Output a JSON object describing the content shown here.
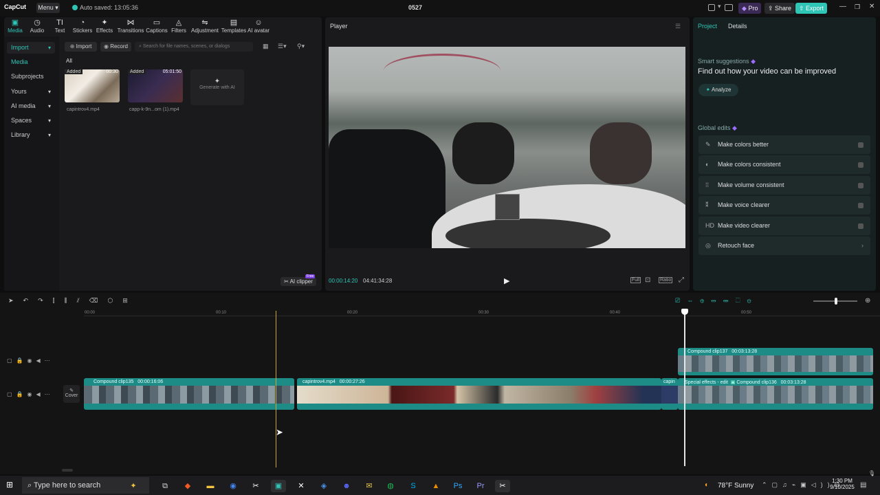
{
  "app": {
    "logo": "CapCut",
    "menu_label": "Menu",
    "autosave": "Auto saved: 13:05:36",
    "project_title": "0527",
    "pro_label": "Pro",
    "share_label": "Share",
    "export_label": "Export"
  },
  "toolbar": [
    {
      "label": "Media",
      "icon": "media-icon",
      "glyph": "▣"
    },
    {
      "label": "Audio",
      "icon": "audio-icon",
      "glyph": "◷"
    },
    {
      "label": "Text",
      "icon": "text-icon",
      "glyph": "TI"
    },
    {
      "label": "Stickers",
      "icon": "stickers-icon",
      "glyph": "◔"
    },
    {
      "label": "Effects",
      "icon": "effects-icon",
      "glyph": "✦"
    },
    {
      "label": "Transitions",
      "icon": "transitions-icon",
      "glyph": "⋈"
    },
    {
      "label": "Captions",
      "icon": "captions-icon",
      "glyph": "▭"
    },
    {
      "label": "Filters",
      "icon": "filters-icon",
      "glyph": "◬"
    },
    {
      "label": "Adjustment",
      "icon": "adjustment-icon",
      "glyph": "⇋"
    },
    {
      "label": "Templates",
      "icon": "templates-icon",
      "glyph": "▤"
    },
    {
      "label": "AI avatar",
      "icon": "ai-avatar-icon",
      "glyph": "☺"
    }
  ],
  "sidebar": [
    {
      "label": "Import",
      "active": true
    },
    {
      "label": "Media",
      "active": true
    },
    {
      "label": "Subprojects"
    },
    {
      "label": "Yours"
    },
    {
      "label": "AI media"
    },
    {
      "label": "Spaces"
    },
    {
      "label": "Library"
    }
  ],
  "media": {
    "import_label": "Import",
    "record_label": "Record",
    "search_placeholder": "Search for file names, scenes, or dialogs",
    "filter_all": "All",
    "items": [
      {
        "badge": "Added",
        "duration": "00:30",
        "name": "capintrov4.mp4"
      },
      {
        "badge": "Added",
        "duration": "05:01:50",
        "name": "capp-k-9n...om (1).mp4"
      }
    ],
    "generate_label": "Generate with AI",
    "ai_clipper_label": "AI clipper",
    "ai_clipper_badge": "Free"
  },
  "player": {
    "title": "Player",
    "current_time": "00:00:14:20",
    "total_time": "04:41:34:28",
    "full_label": "Full",
    "ratio_label": "Ratio"
  },
  "right": {
    "tab_project": "Project",
    "tab_details": "Details",
    "smart_title": "Smart suggestions",
    "smart_desc": "Find out how your video can be improved",
    "analyze_label": "Analyze",
    "global_title": "Global edits",
    "edits": [
      {
        "label": "Make colors better",
        "icon": "wand-icon",
        "glyph": "✎"
      },
      {
        "label": "Make colors consistent",
        "icon": "palette-icon",
        "glyph": "◐"
      },
      {
        "label": "Make volume consistent",
        "icon": "volume-bars-icon",
        "glyph": "⁞⁞"
      },
      {
        "label": "Make voice clearer",
        "icon": "voice-icon",
        "glyph": "⁑"
      },
      {
        "label": "Make video clearer",
        "icon": "hd-icon",
        "glyph": "HD"
      },
      {
        "label": "Retouch face",
        "icon": "face-icon",
        "glyph": "◎"
      }
    ]
  },
  "timeline": {
    "ticks": [
      "00:00",
      "00:10",
      "00:20",
      "00:30",
      "00:40",
      "00:50"
    ],
    "cover_label": "Cover",
    "clips": {
      "c137": {
        "name": "Compound clip137",
        "duration": "00:03:13:28"
      },
      "c135": {
        "name": "Compound clip135",
        "duration": "00:00:16:06"
      },
      "intro": {
        "name": "capintrov4.mp4",
        "duration": "00:00:27:26"
      },
      "capin": {
        "name": "capin"
      },
      "sfx": {
        "name": "Special effects - edit"
      },
      "c136": {
        "name": "Compound clip136",
        "duration": "00:03:13:28"
      }
    }
  },
  "taskbar": {
    "search_placeholder": "Type here to search",
    "weather": "78°F  Sunny",
    "time": "1:30 PM",
    "date": "9/10/2025"
  },
  "colors": {
    "accent": "#2ec4b6",
    "clip": "#1d8c86",
    "pro": "#7b3fe4"
  }
}
